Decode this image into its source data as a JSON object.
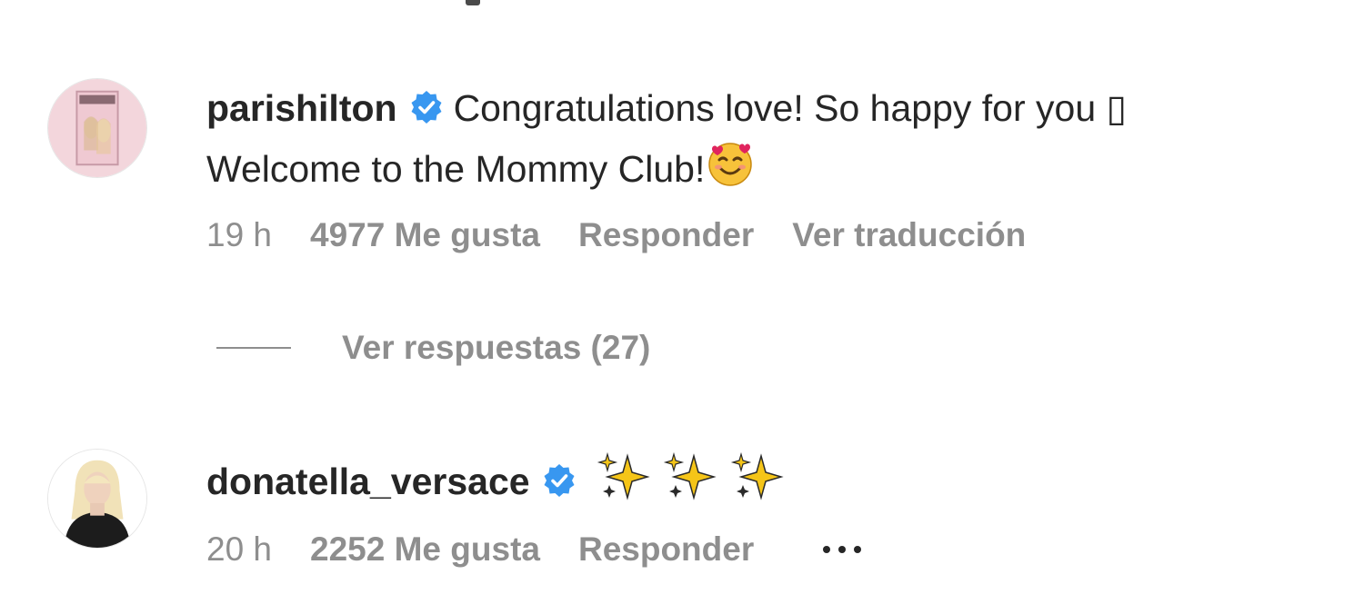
{
  "comments": [
    {
      "username": "parishilton",
      "verified": true,
      "text_line1": "Congratulations love! So happy for you",
      "text_line1_trail": "▯",
      "text_line2": "Welcome to the Mommy Club!",
      "text_emoji": "smiling-face-with-hearts-icon",
      "time": "19 h",
      "likes": "4977 Me gusta",
      "reply_label": "Responder",
      "translate_label": "Ver traducción",
      "replies_label": "Ver respuestas (27)"
    },
    {
      "username": "donatella_versace",
      "verified": true,
      "text_emoji": [
        "sparkles-icon",
        "sparkles-icon",
        "sparkles-icon"
      ],
      "time": "20 h",
      "likes": "2252 Me gusta",
      "reply_label": "Responder",
      "more_icon": "more-options-icon"
    }
  ],
  "colors": {
    "text_primary": "#262626",
    "text_secondary": "#8e8e8e",
    "verified_blue": "#3897f0",
    "background": "#ffffff"
  }
}
